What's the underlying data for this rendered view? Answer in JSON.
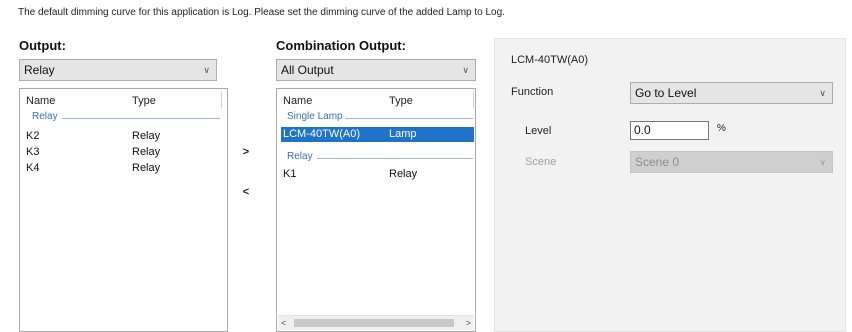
{
  "notice": "The default dimming curve for this application is Log. Please set the dimming curve of the added Lamp to Log.",
  "output": {
    "title": "Output:",
    "dropdown_value": "Relay",
    "columns": [
      "Name",
      "Type"
    ],
    "group": "Relay",
    "rows": [
      {
        "name": "K2",
        "type": "Relay"
      },
      {
        "name": "K3",
        "type": "Relay"
      },
      {
        "name": "K4",
        "type": "Relay"
      }
    ]
  },
  "transfer": {
    "add_label": ">",
    "remove_label": "<"
  },
  "combination": {
    "title": "Combination Output:",
    "dropdown_value": "All Output",
    "columns": [
      "Name",
      "Type"
    ],
    "groups": [
      {
        "label": "Single Lamp",
        "rows": [
          {
            "name": "LCM-40TW(A0)",
            "type": "Lamp",
            "selected": true
          }
        ]
      },
      {
        "label": "Relay",
        "rows": [
          {
            "name": "K1",
            "type": "Relay",
            "selected": false
          }
        ]
      }
    ],
    "scroll_left": "<",
    "scroll_right": ">"
  },
  "details": {
    "device_name": "LCM-40TW(A0)",
    "function_label": "Function",
    "function_value": "Go to Level",
    "level_label": "Level",
    "level_value": "0.0",
    "level_unit": "%",
    "scene_label": "Scene",
    "scene_value": "Scene 0"
  },
  "colors": {
    "selection": "#1f73c9",
    "group_label": "#3a6cc0",
    "panel_bg": "#f2f2f2"
  },
  "icons": {
    "dropdown": "chevron-down-icon",
    "scroll_left": "scroll-left-arrow-icon",
    "scroll_right": "scroll-right-arrow-icon"
  }
}
